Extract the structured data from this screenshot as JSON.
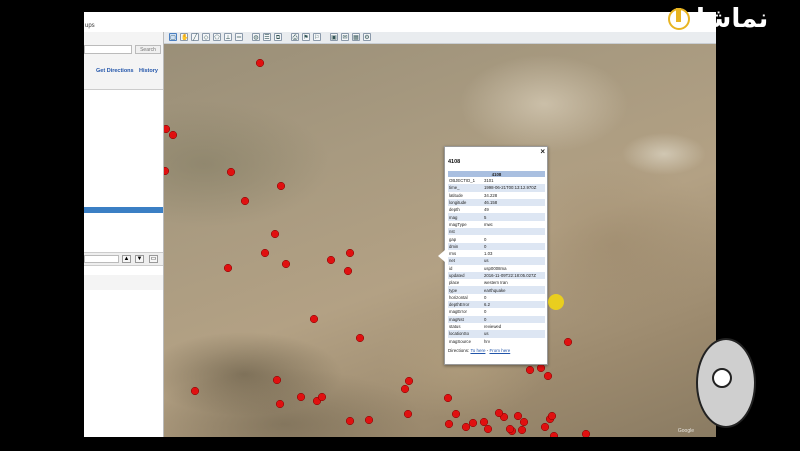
{
  "app": {
    "title_fragment": "ups"
  },
  "search": {
    "placeholder": "",
    "button_label": "Search"
  },
  "side_links": {
    "directions": "Get Directions",
    "history": "History"
  },
  "toolbar": {
    "icons": [
      "select-tool-icon",
      "pan-tool-icon",
      "line-tool-icon",
      "shape-tool-icon",
      "polygon-tool-icon",
      "measure-tool-icon",
      "ruler-icon",
      "globe-icon",
      "layers-icon",
      "overlay-icon",
      "print-icon",
      "placemark-icon",
      "flag-icon",
      "photo-icon",
      "email-icon",
      "map-view-icon",
      "settings-icon"
    ]
  },
  "side_controls": {
    "up_label": "▲",
    "down_label": "▼",
    "folder_label": "▭"
  },
  "popup": {
    "id": "4108",
    "close_label": "×",
    "header": "4108",
    "fields": [
      {
        "key": "OBJECTID_1",
        "value": "3101"
      },
      {
        "key": "time_",
        "value": "1998-06-21T00:13:12.970Z"
      },
      {
        "key": "latitude",
        "value": "34.228"
      },
      {
        "key": "longitude",
        "value": "46.158"
      },
      {
        "key": "depth",
        "value": "49"
      },
      {
        "key": "mag",
        "value": "5"
      },
      {
        "key": "magType",
        "value": "mwc"
      },
      {
        "key": "nst",
        "value": ""
      },
      {
        "key": "gap",
        "value": "0"
      },
      {
        "key": "dmin",
        "value": "0"
      },
      {
        "key": "rms",
        "value": "1.03"
      },
      {
        "key": "net",
        "value": "us"
      },
      {
        "key": "id",
        "value": "usp0008ma"
      },
      {
        "key": "updated",
        "value": "2016-11-09T22:18:05.027Z"
      },
      {
        "key": "place",
        "value": "western Iran"
      },
      {
        "key": "type",
        "value": "earthquake"
      },
      {
        "key": "horizontal",
        "value": "0"
      },
      {
        "key": "depthError",
        "value": "6.2"
      },
      {
        "key": "magError",
        "value": "0"
      },
      {
        "key": "magNst",
        "value": "0"
      },
      {
        "key": "status",
        "value": "reviewed"
      },
      {
        "key": "locationSo",
        "value": "us"
      },
      {
        "key": "magSource",
        "value": "hrv"
      }
    ],
    "directions_label": "Directions:",
    "to_here": "To here",
    "separator": " - ",
    "from_here": "From here"
  },
  "map": {
    "marker_color": "#e01010",
    "credit": "Google"
  },
  "logo": {
    "text": "نماشا"
  },
  "colors": {
    "selection": "#3b7fc4",
    "popup_header": "#a9bfe0",
    "popup_stripe": "#dde6f3",
    "link": "#2255aa"
  }
}
